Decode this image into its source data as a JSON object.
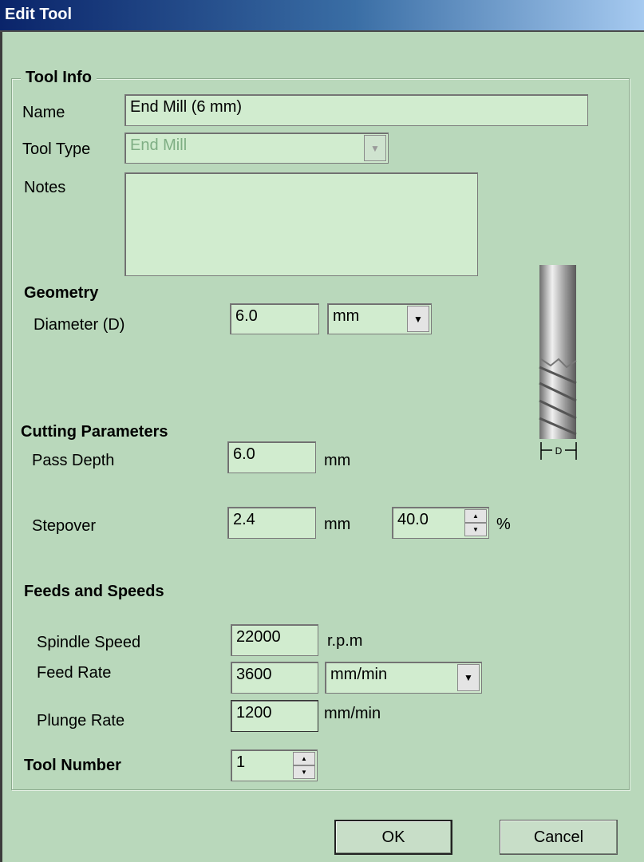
{
  "window": {
    "title": "Edit Tool"
  },
  "tool_info": {
    "legend": "Tool Info",
    "name_label": "Name",
    "name_value": "End Mill (6 mm)",
    "tool_type_label": "Tool Type",
    "tool_type_value": "End Mill",
    "notes_label": "Notes",
    "notes_value": ""
  },
  "geometry": {
    "heading": "Geometry",
    "diameter_label": "Diameter (D)",
    "diameter_value": "6.0",
    "units_value": "mm"
  },
  "diagram": {
    "dimension_label": "D"
  },
  "cutting": {
    "heading": "Cutting Parameters",
    "pass_depth_label": "Pass Depth",
    "pass_depth_value": "6.0",
    "pass_depth_unit": "mm",
    "stepover_label": "Stepover",
    "stepover_value": "2.4",
    "stepover_unit": "mm",
    "stepover_percent_value": "40.0",
    "percent_symbol": "%"
  },
  "feeds": {
    "heading": "Feeds and Speeds",
    "spindle_label": "Spindle Speed",
    "spindle_value": "22000",
    "spindle_unit": "r.p.m",
    "feed_label": "Feed Rate",
    "feed_value": "3600",
    "feed_unit_value": "mm/min",
    "plunge_label": "Plunge Rate",
    "plunge_value": "1200",
    "plunge_unit": "mm/min"
  },
  "tool_number": {
    "label": "Tool Number",
    "value": "1"
  },
  "buttons": {
    "ok": "OK",
    "cancel": "Cancel"
  },
  "icons": {
    "dropdown": "chevron-down-icon",
    "spin_up": "arrow-up-icon",
    "spin_down": "arrow-down-icon"
  },
  "colors": {
    "background": "#b9d8bb",
    "field": "#d1eccf",
    "title_start": "#0a246a",
    "title_end": "#a6caf0"
  }
}
